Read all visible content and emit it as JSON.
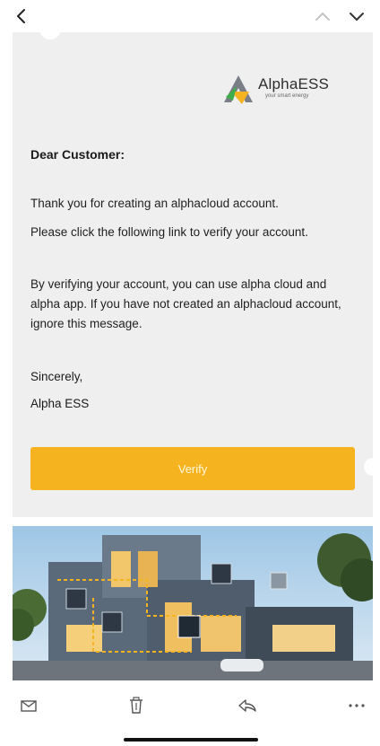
{
  "nav": {
    "back_icon": "chevron-left-icon",
    "prev_icon": "chevron-up-icon",
    "next_icon": "chevron-down-icon"
  },
  "email": {
    "logo_text": "AlphaESS",
    "logo_tagline": "your smart energy",
    "greeting": "Dear Customer:",
    "paragraph1": "Thank you for creating an alphacloud account.",
    "paragraph2": "Please click the following link to verify your account.",
    "paragraph3": "By verifying your account, you can use alpha cloud and alpha app. If you have not created an alphacloud account, ignore this message.",
    "sign_off": "Sincerely,",
    "signature": "Alpha ESS",
    "verify_label": "Verify",
    "accent_color": "#f4b31f"
  },
  "toolbar": {
    "icons": [
      "mail-icon",
      "trash-icon",
      "reply-icon",
      "more-icon"
    ]
  }
}
